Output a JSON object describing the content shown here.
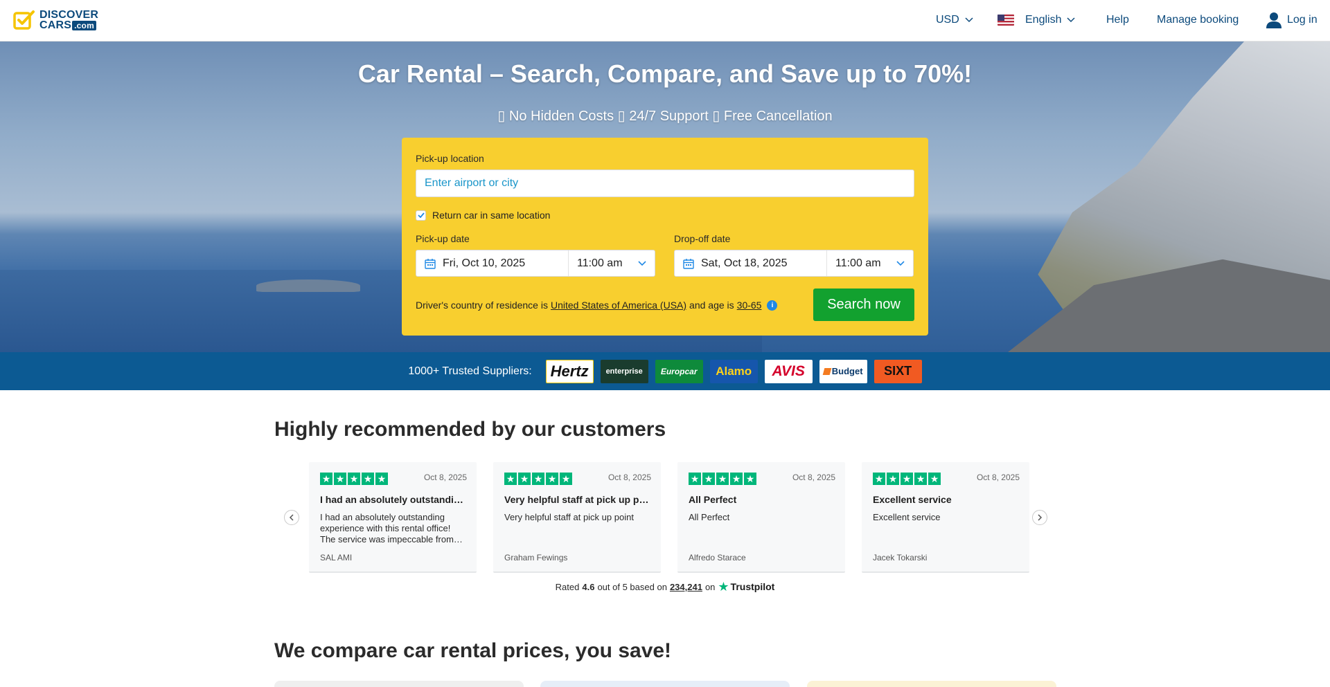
{
  "header": {
    "logo_line1": "DISCOVER",
    "logo_line2": "CARS",
    "logo_com": ".com",
    "currency": "USD",
    "language": "English",
    "help": "Help",
    "manage_booking": "Manage booking",
    "login": "Log in"
  },
  "hero": {
    "title": "Car Rental – Search, Compare, and Save up to 70%!",
    "subtitle": "No Hidden Costs",
    "subtitle_2": "24/7 Support",
    "subtitle_3": "Free Cancellation"
  },
  "search": {
    "pickup_label": "Pick-up location",
    "pickup_placeholder": "Enter airport or city",
    "same_location": "Return car in same location",
    "same_location_checked": true,
    "pickup_date_label": "Pick-up date",
    "pickup_date": "Fri, Oct 10, 2025",
    "pickup_time": "11:00 am",
    "dropoff_date_label": "Drop-off date",
    "dropoff_date": "Sat, Oct 18, 2025",
    "dropoff_time": "11:00 am",
    "residence_prefix": "Driver's country of residence is",
    "residence_country": "United States of America (USA)",
    "residence_mid": "and age is",
    "age_range": "30-65",
    "search_button": "Search now"
  },
  "suppliers": {
    "label": "1000+ Trusted Suppliers:",
    "logos": [
      "Hertz",
      "enterprise",
      "Europcar",
      "Alamo",
      "AVIS",
      "Budget",
      "SIXT"
    ]
  },
  "reviews": {
    "title": "Highly recommended by our customers",
    "items": [
      {
        "date": "Oct 8, 2025",
        "title": "I had an absolutely outstanding…",
        "body": "I had an absolutely outstanding experience with this rental office! The service was impeccable from…",
        "author": "SAL AMI"
      },
      {
        "date": "Oct 8, 2025",
        "title": "Very helpful staff at pick up point",
        "body": "Very helpful staff at pick up point",
        "author": "Graham Fewings"
      },
      {
        "date": "Oct 8, 2025",
        "title": "All Perfect",
        "body": "All Perfect",
        "author": "Alfredo Starace"
      },
      {
        "date": "Oct 8, 2025",
        "title": "Excellent service",
        "body": "Excellent service",
        "author": "Jacek Tokarski"
      }
    ],
    "rated_prefix": "Rated",
    "rating": "4.6",
    "rated_mid": "out of 5 based on",
    "count": "234,241",
    "rated_on": "on",
    "trustpilot": "Trustpilot"
  },
  "compare": {
    "title": "We compare car rental prices, you save!"
  },
  "colors": {
    "brand_blue": "#0c4a7c",
    "form_yellow": "#f8cf2f",
    "search_green": "#12a12f",
    "suppliers_bar": "#0c5a93",
    "trustpilot_green": "#00b67a"
  }
}
